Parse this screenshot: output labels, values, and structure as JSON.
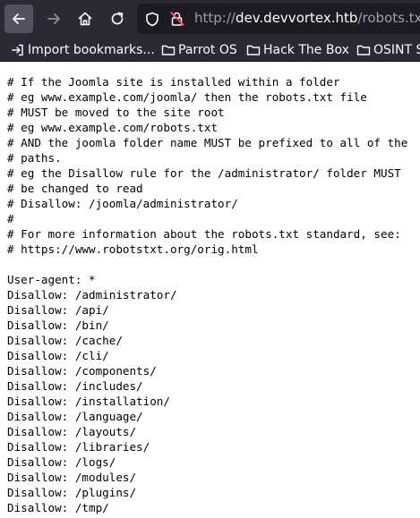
{
  "browser": {
    "url_prefix": "http://",
    "url_host": "dev.devvortex.htb",
    "url_path": "/robots.txt"
  },
  "bookmarks": [
    {
      "label": "Import bookmarks...",
      "icon": "import-icon"
    },
    {
      "label": "Parrot OS",
      "icon": "folder-icon"
    },
    {
      "label": "Hack The Box",
      "icon": "folder-icon"
    },
    {
      "label": "OSINT S",
      "icon": "folder-icon"
    }
  ],
  "document": {
    "lines": [
      "# If the Joomla site is installed within a folder",
      "# eg www.example.com/joomla/ then the robots.txt file",
      "# MUST be moved to the site root",
      "# eg www.example.com/robots.txt",
      "# AND the joomla folder name MUST be prefixed to all of the",
      "# paths.",
      "# eg the Disallow rule for the /administrator/ folder MUST",
      "# be changed to read",
      "# Disallow: /joomla/administrator/",
      "#",
      "# For more information about the robots.txt standard, see:",
      "# https://www.robotstxt.org/orig.html",
      "",
      "User-agent: *",
      "Disallow: /administrator/",
      "Disallow: /api/",
      "Disallow: /bin/",
      "Disallow: /cache/",
      "Disallow: /cli/",
      "Disallow: /components/",
      "Disallow: /includes/",
      "Disallow: /installation/",
      "Disallow: /language/",
      "Disallow: /layouts/",
      "Disallow: /libraries/",
      "Disallow: /logs/",
      "Disallow: /modules/",
      "Disallow: /plugins/",
      "Disallow: /tmp/"
    ]
  }
}
